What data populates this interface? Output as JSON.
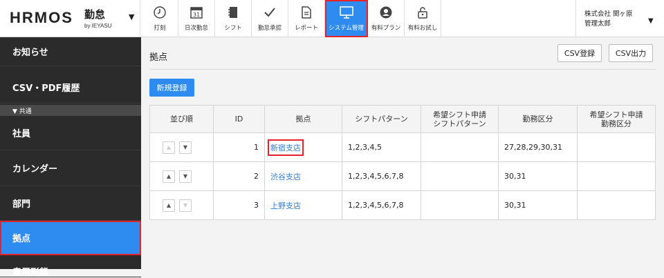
{
  "brand": {
    "logo": "HRMOS",
    "product": "勤怠",
    "sub": "by IEYASU"
  },
  "nav": [
    {
      "label": "打刻",
      "icon": "clock-icon"
    },
    {
      "label": "日次勤怠",
      "icon": "calendar-icon",
      "badge": "31"
    },
    {
      "label": "シフト",
      "icon": "notebook-icon"
    },
    {
      "label": "勤怠承認",
      "icon": "checkmark-icon"
    },
    {
      "label": "レポート",
      "icon": "document-icon"
    },
    {
      "label": "システム管理",
      "icon": "monitor-icon",
      "active": true
    },
    {
      "label": "有料プラン",
      "icon": "user-icon"
    },
    {
      "label": "有料お試し",
      "icon": "unlock-icon"
    }
  ],
  "company": {
    "name": "株式会社 関ヶ原",
    "user": "管理太郎"
  },
  "sidebar": {
    "items": [
      {
        "label": "お知らせ"
      },
      {
        "label": "CSV・PDF履歴"
      },
      {
        "label": "社員"
      },
      {
        "label": "カレンダー"
      },
      {
        "label": "部門"
      },
      {
        "label": "拠点",
        "active": true
      },
      {
        "label": "雇用形態"
      }
    ],
    "group_label": "▼ 共通"
  },
  "main": {
    "title": "拠点",
    "csv_import": "CSV登録",
    "csv_export": "CSV出力",
    "new_button": "新規登録",
    "headers": [
      "並び順",
      "ID",
      "拠点",
      "シフトパターン",
      "希望シフト申請\nシフトパターン",
      "勤務区分",
      "希望シフト申請\n勤務区分"
    ],
    "rows": [
      {
        "id": "1",
        "name": "新宿支店",
        "shift": "1,2,3,4,5",
        "req_shift": "",
        "work": "27,28,29,30,31",
        "req_work": ""
      },
      {
        "id": "2",
        "name": "渋谷支店",
        "shift": "1,2,3,4,5,6,7,8",
        "req_shift": "",
        "work": "30,31",
        "req_work": ""
      },
      {
        "id": "3",
        "name": "上野支店",
        "shift": "1,2,3,4,5,6,7,8",
        "req_shift": "",
        "work": "30,31",
        "req_work": ""
      }
    ]
  },
  "colors": {
    "accent": "#2e8bf0",
    "highlight": "#e8202a",
    "sidebar": "#2b2b2b"
  }
}
